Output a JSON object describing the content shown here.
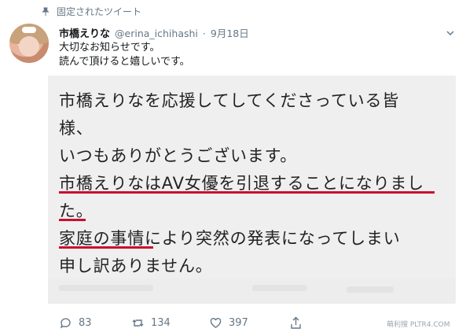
{
  "pinned_label": "固定されたツイート",
  "author": {
    "name": "市橋えりな",
    "handle": "@erina_ichihashi",
    "separator": "·",
    "date": "9月18日"
  },
  "tweet": {
    "lines": [
      "大切なお知らせです。",
      "読んで頂けると嬉しいです。"
    ]
  },
  "media": {
    "text_lines": [
      "市橋えりなを応援してしてくださっている皆",
      "様、",
      "いつもありがとうございます。",
      "市橋えりなはAV女優を引退することになりまし",
      "た。",
      "家庭の事情により突然の発表になってしまい",
      "申し訳ありません。"
    ]
  },
  "actions": {
    "reply_count": "83",
    "retweet_count": "134",
    "like_count": "397"
  },
  "watermark": "萌利搜 PLTR4.COM",
  "colors": {
    "text": "#14171a",
    "muted": "#657786",
    "underline": "#c8102e",
    "media_bg": "#efefef"
  },
  "icons": [
    "pin-icon",
    "chevron-down-icon",
    "reply-icon",
    "retweet-icon",
    "like-icon",
    "share-icon"
  ]
}
